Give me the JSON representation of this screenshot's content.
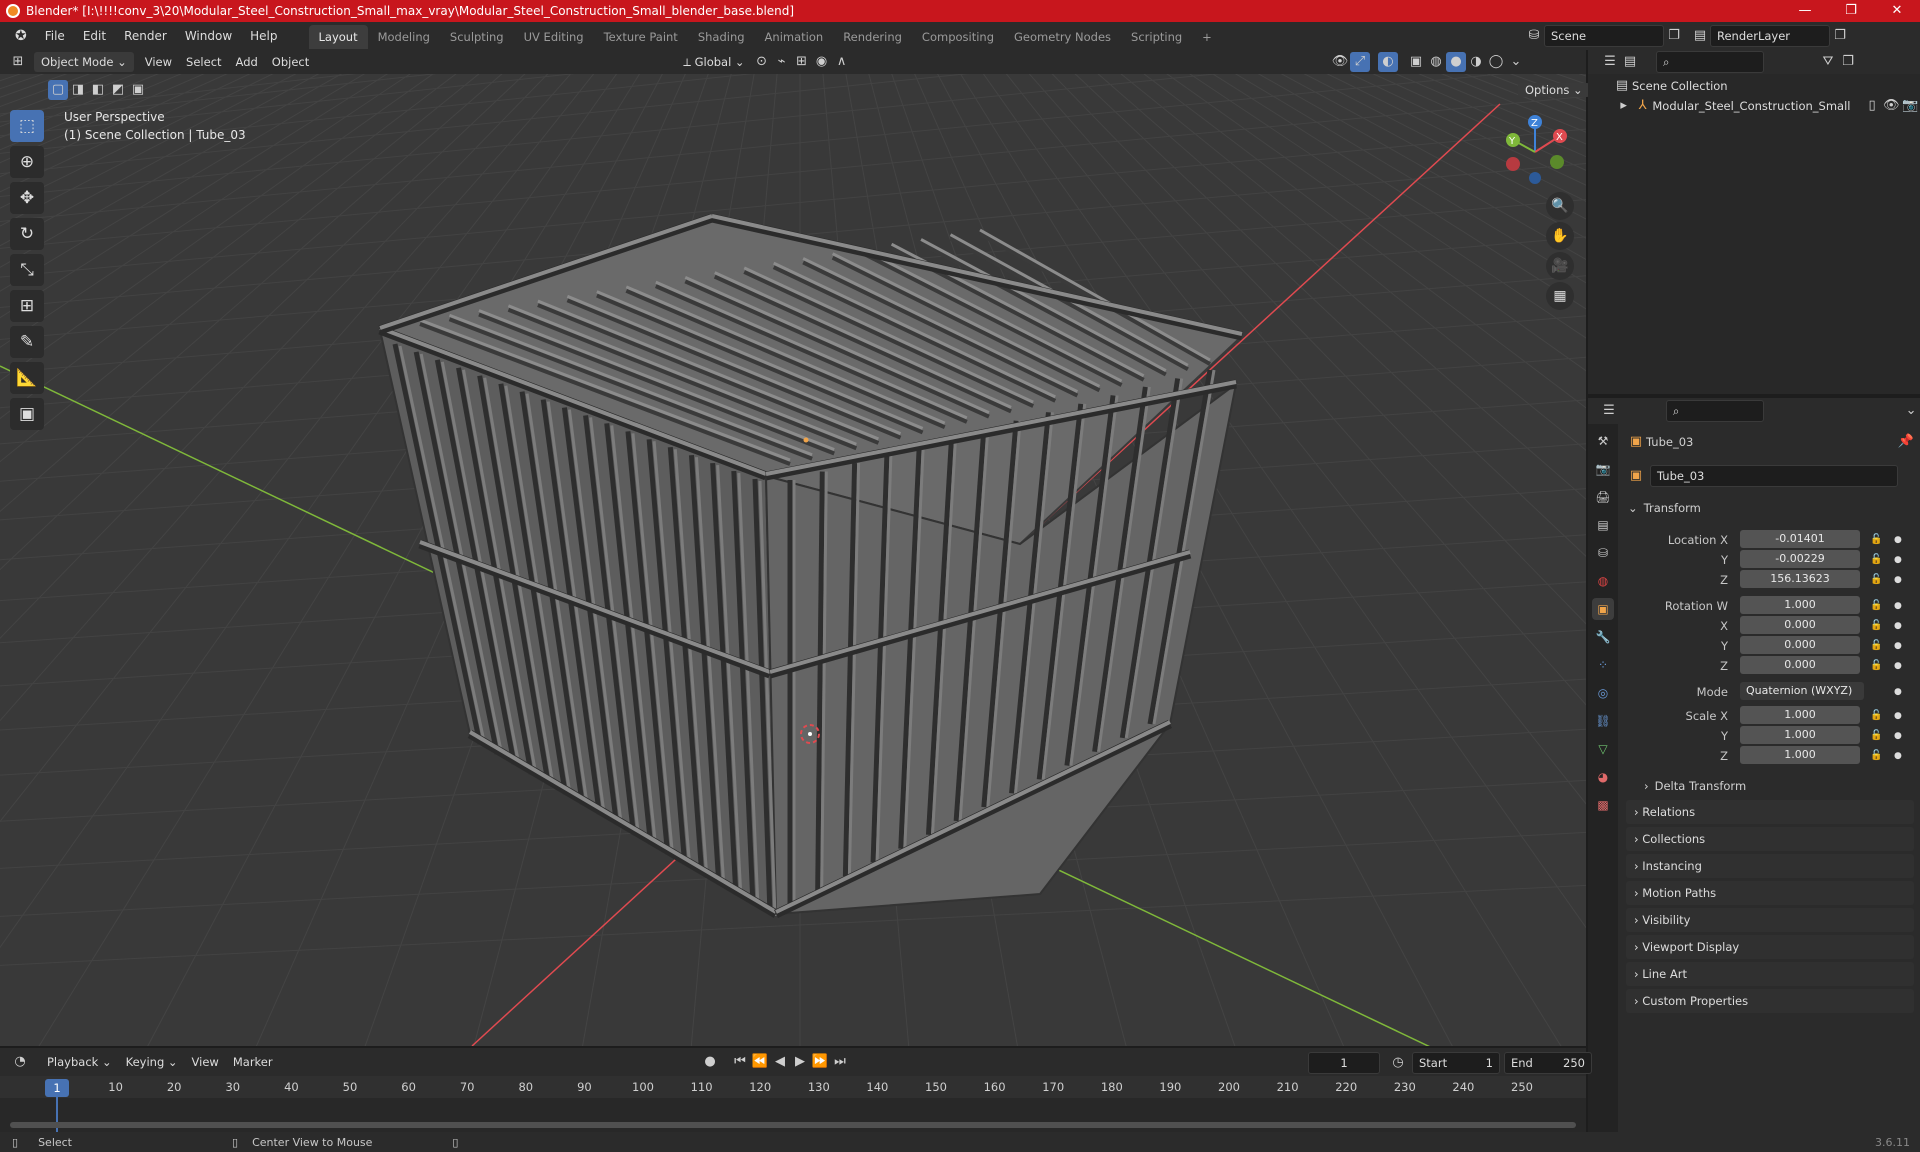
{
  "window": {
    "title": "Blender* [I:\\!!!!conv_3\\20\\Modular_Steel_Construction_Small_max_vray\\Modular_Steel_Construction_Small_blender_base.blend]",
    "minimize": "—",
    "maximize": "❐",
    "close": "✕"
  },
  "menu": {
    "items": [
      "File",
      "Edit",
      "Render",
      "Window",
      "Help"
    ]
  },
  "workspaces": {
    "tabs": [
      "Layout",
      "Modeling",
      "Sculpting",
      "UV Editing",
      "Texture Paint",
      "Shading",
      "Animation",
      "Rendering",
      "Compositing",
      "Geometry Nodes",
      "Scripting"
    ],
    "add": "+"
  },
  "scene": {
    "name": "Scene",
    "render_layer": "RenderLayer"
  },
  "viewport_header": {
    "mode": "Object Mode",
    "menus": [
      "View",
      "Select",
      "Add",
      "Object"
    ],
    "transform_orientation": "Global",
    "options": "Options"
  },
  "viewport": {
    "perspective": "User Perspective",
    "collection_info": "(1) Scene Collection | Tube_03"
  },
  "gizmo": {
    "x": "X",
    "y": "Y",
    "z": "Z"
  },
  "colors": {
    "accent": "#4772b3",
    "title_bar": "#c8161d",
    "x_axis": "#e04a50",
    "y_axis": "#7fb83a",
    "z_axis": "#3e82d8",
    "model": "#7c7c7c"
  },
  "outliner": {
    "root": "Scene Collection",
    "item": "Modular_Steel_Construction_Small"
  },
  "properties": {
    "object_name": "Tube_03",
    "data_name": "Tube_03",
    "transform_header": "Transform",
    "location": {
      "label": "Location X",
      "y_label": "Y",
      "z_label": "Z",
      "x": "-0.01401",
      "y": "-0.00229",
      "z": "156.13623"
    },
    "rotation": {
      "label": "Rotation W",
      "x_label": "X",
      "y_label": "Y",
      "z_label": "Z",
      "w": "1.000",
      "x": "0.000",
      "y": "0.000",
      "z": "0.000"
    },
    "mode": {
      "label": "Mode",
      "value": "Quaternion (WXYZ)"
    },
    "scale": {
      "label": "Scale X",
      "y_label": "Y",
      "z_label": "Z",
      "x": "1.000",
      "y": "1.000",
      "z": "1.000"
    },
    "delta": "Delta Transform",
    "sections": [
      "Relations",
      "Collections",
      "Instancing",
      "Motion Paths",
      "Visibility",
      "Viewport Display",
      "Line Art",
      "Custom Properties"
    ]
  },
  "timeline": {
    "menus": [
      "Playback",
      "Keying",
      "View",
      "Marker"
    ],
    "current_frame": "1",
    "start_label": "Start",
    "start": "1",
    "end_label": "End",
    "end": "250",
    "ticks": [
      "10",
      "20",
      "30",
      "40",
      "50",
      "60",
      "70",
      "80",
      "90",
      "100",
      "110",
      "120",
      "130",
      "140",
      "150",
      "160",
      "170",
      "180",
      "190",
      "200",
      "210",
      "220",
      "230",
      "240",
      "250"
    ]
  },
  "status": {
    "select": "Select",
    "center": "Center View to Mouse",
    "version": "3.6.11"
  }
}
